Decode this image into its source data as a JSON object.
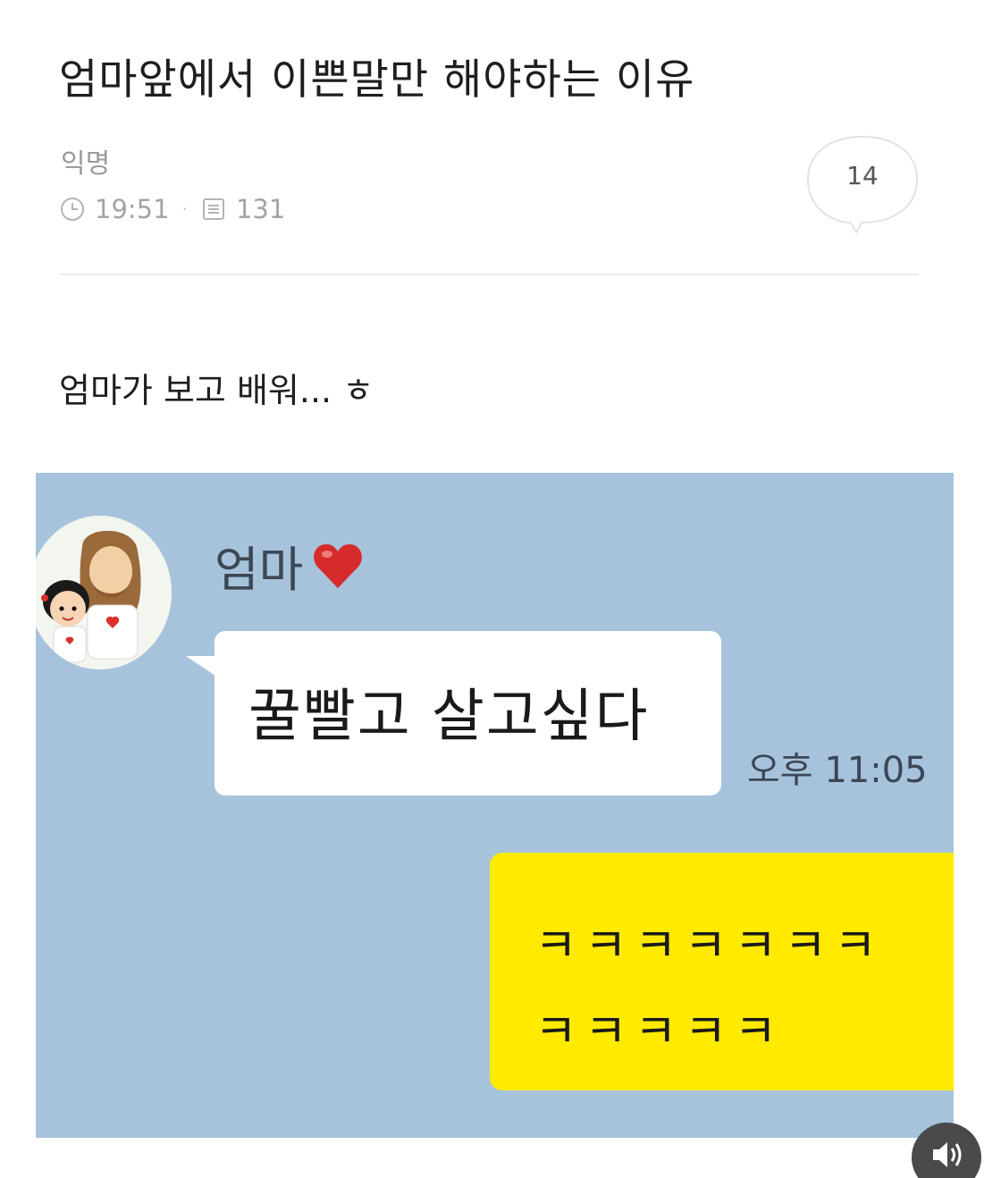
{
  "post": {
    "title": "엄마앞에서 이쁜말만 해야하는 이유",
    "author": "익명",
    "time": "19:51",
    "views": "131",
    "comment_count": "14",
    "body": "엄마가 보고 배워... ㅎ"
  },
  "chat": {
    "sender_name": "엄마",
    "incoming_message": "꿀빨고 살고싶다",
    "incoming_time": "오후 11:05",
    "outgoing_line_1": "ㅋㅋㅋㅋㅋㅋㅋ",
    "outgoing_line_2": "ㅋㅋㅋㅋㅋ",
    "background_color": "#a7c3dc",
    "outgoing_bubble_color": "#ffea00",
    "incoming_bubble_color": "#ffffff"
  },
  "icons": {
    "clock": "clock-icon",
    "views": "document-icon",
    "comment": "speech-bubble-icon",
    "heart": "heart-icon",
    "sound": "speaker-icon"
  }
}
